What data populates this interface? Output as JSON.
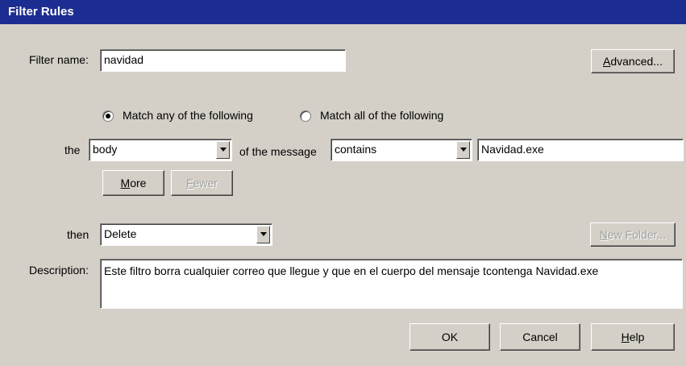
{
  "window": {
    "title": "Filter Rules"
  },
  "filter_name": {
    "label": "Filter name:",
    "value": "navidad"
  },
  "advanced_button": {
    "prefix": "",
    "underlined": "A",
    "suffix": "dvanced..."
  },
  "match": {
    "any_label": "Match any of the following",
    "all_label": "Match all of the following",
    "selected": "any"
  },
  "rule": {
    "the_label": "the",
    "field_value": "body",
    "of_message_label": "of the message",
    "operator_value": "contains",
    "text_value": "Navidad.exe"
  },
  "more_button": {
    "underlined": "M",
    "suffix": "ore"
  },
  "fewer_button": {
    "underlined": "F",
    "suffix": "ewer"
  },
  "action": {
    "then_label": "then",
    "value": "Delete"
  },
  "new_folder_button": {
    "underlined": "N",
    "suffix": "ew Folder..."
  },
  "description": {
    "label": "Description:",
    "value": "Este filtro borra cualquier correo que llegue y que en el cuerpo del mensaje tcontenga Navidad.exe"
  },
  "ok_button": {
    "label": "OK"
  },
  "cancel_button": {
    "label": "Cancel"
  },
  "help_button": {
    "underlined": "H",
    "suffix": "elp"
  }
}
